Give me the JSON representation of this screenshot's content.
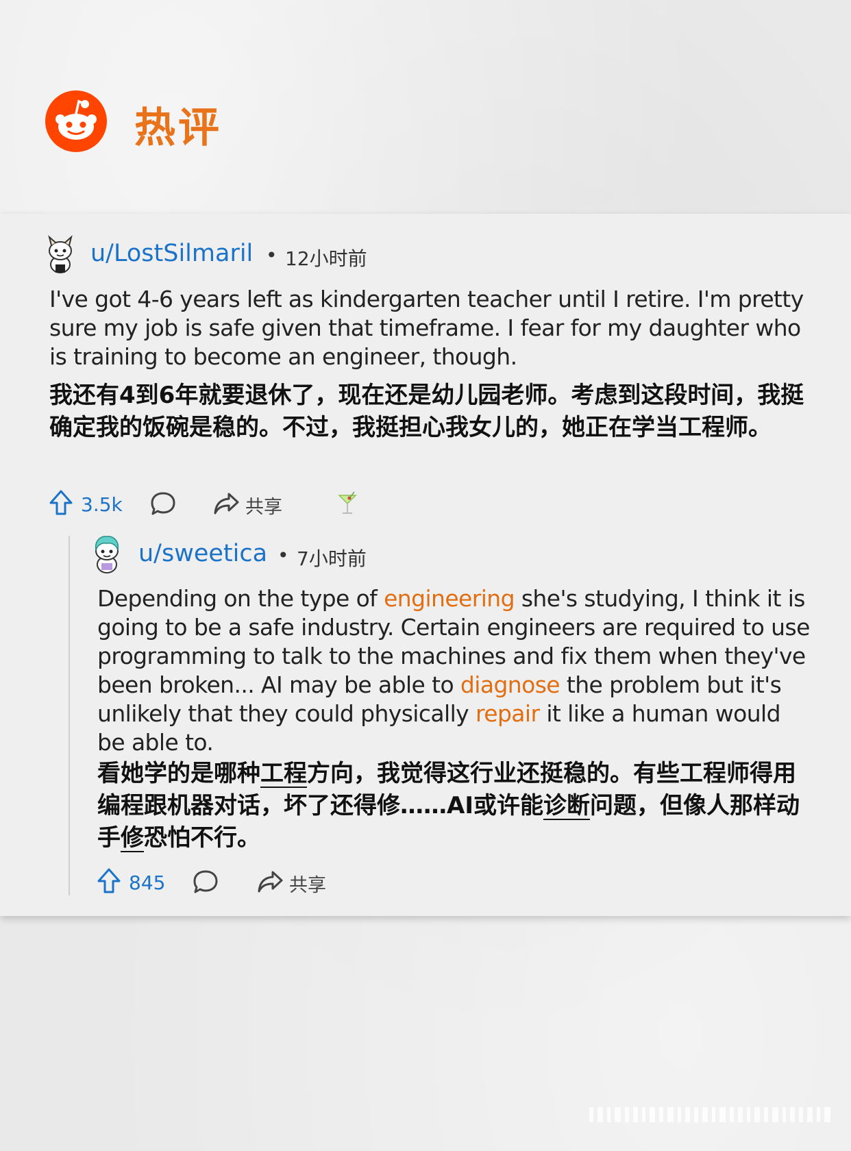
{
  "header": {
    "title": "热评",
    "logo_icon": "reddit-snoo-icon"
  },
  "colors": {
    "brand_orange": "#ff4500",
    "title_orange": "#e8731a",
    "username_blue": "#1a72c9",
    "highlight_orange": "#e26e12"
  },
  "comments": [
    {
      "username": "u/LostSilmaril",
      "separator": "•",
      "time": "12小时前",
      "avatar_icon": "snoo-avatar-icon",
      "body_en": "I've got 4-6 years left as kindergarten teacher until I retire. I'm pretty sure my job is safe given that timeframe. I fear for my daughter who is training to become an engineer, though.",
      "body_zh": "我还有4到6年就要退休了，现在还是幼儿园老师。考虑到这段时间，我挺确定我的饭碗是稳的。不过，我挺担心我女儿的，她正在学当工程师。",
      "upvotes": "3.5k",
      "share_label": "共享",
      "award_icon": "cocktail-award-icon"
    },
    {
      "username": "u/sweetica",
      "separator": "•",
      "time": "7小时前",
      "avatar_icon": "snoo-avatar-icon",
      "body_en_parts": [
        "Depending on the type of ",
        "engineering",
        " she's studying, I think it is going to be a safe industry. Certain engineers are required to use programming to talk to the machines and fix them when they've been broken... AI may be able to ",
        "diagnose",
        " the problem but it's unlikely that they could physically ",
        "repair",
        " it like a human would be able to."
      ],
      "body_zh_parts": [
        "看她学的是哪种",
        "工程",
        "方向，我觉得这行业还挺稳的。有些工程师得用编程跟机器对话，坏了还得修……AI或许能",
        "诊断",
        "问题，但像人那样动手",
        "修",
        "恐怕不行。"
      ],
      "upvotes": "845",
      "share_label": "共享"
    }
  ]
}
